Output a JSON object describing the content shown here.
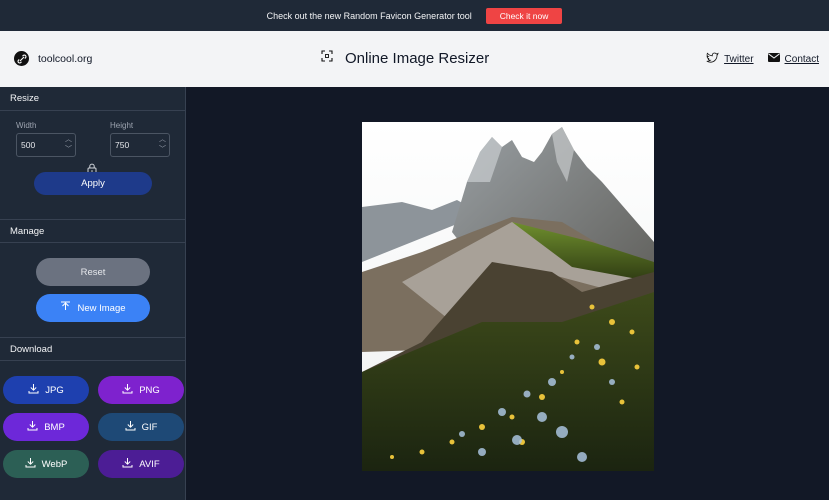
{
  "topbar": {
    "text": "Check out the new Random Favicon Generator tool",
    "button": "Check it now"
  },
  "header": {
    "brand": "toolcool.org",
    "title": "Online Image Resizer",
    "links": {
      "twitter": "Twitter",
      "contact": "Contact"
    }
  },
  "sidebar": {
    "resize": {
      "heading": "Resize",
      "width_label": "Width",
      "width_value": "500",
      "height_label": "Height",
      "height_value": "750",
      "apply": "Apply"
    },
    "manage": {
      "heading": "Manage",
      "reset": "Reset",
      "new_image": "New Image"
    },
    "download": {
      "heading": "Download",
      "formats": [
        "JPG",
        "PNG",
        "BMP",
        "GIF",
        "WebP",
        "AVIF"
      ]
    }
  },
  "colors": {
    "accent_red": "#ef4444",
    "apply_blue": "#1e3a8a",
    "new_image_blue": "#3b82f6"
  },
  "icons": [
    "link-icon",
    "crop-icon",
    "twitter-icon",
    "mail-icon",
    "lock-icon",
    "upload-icon",
    "download-icon"
  ]
}
